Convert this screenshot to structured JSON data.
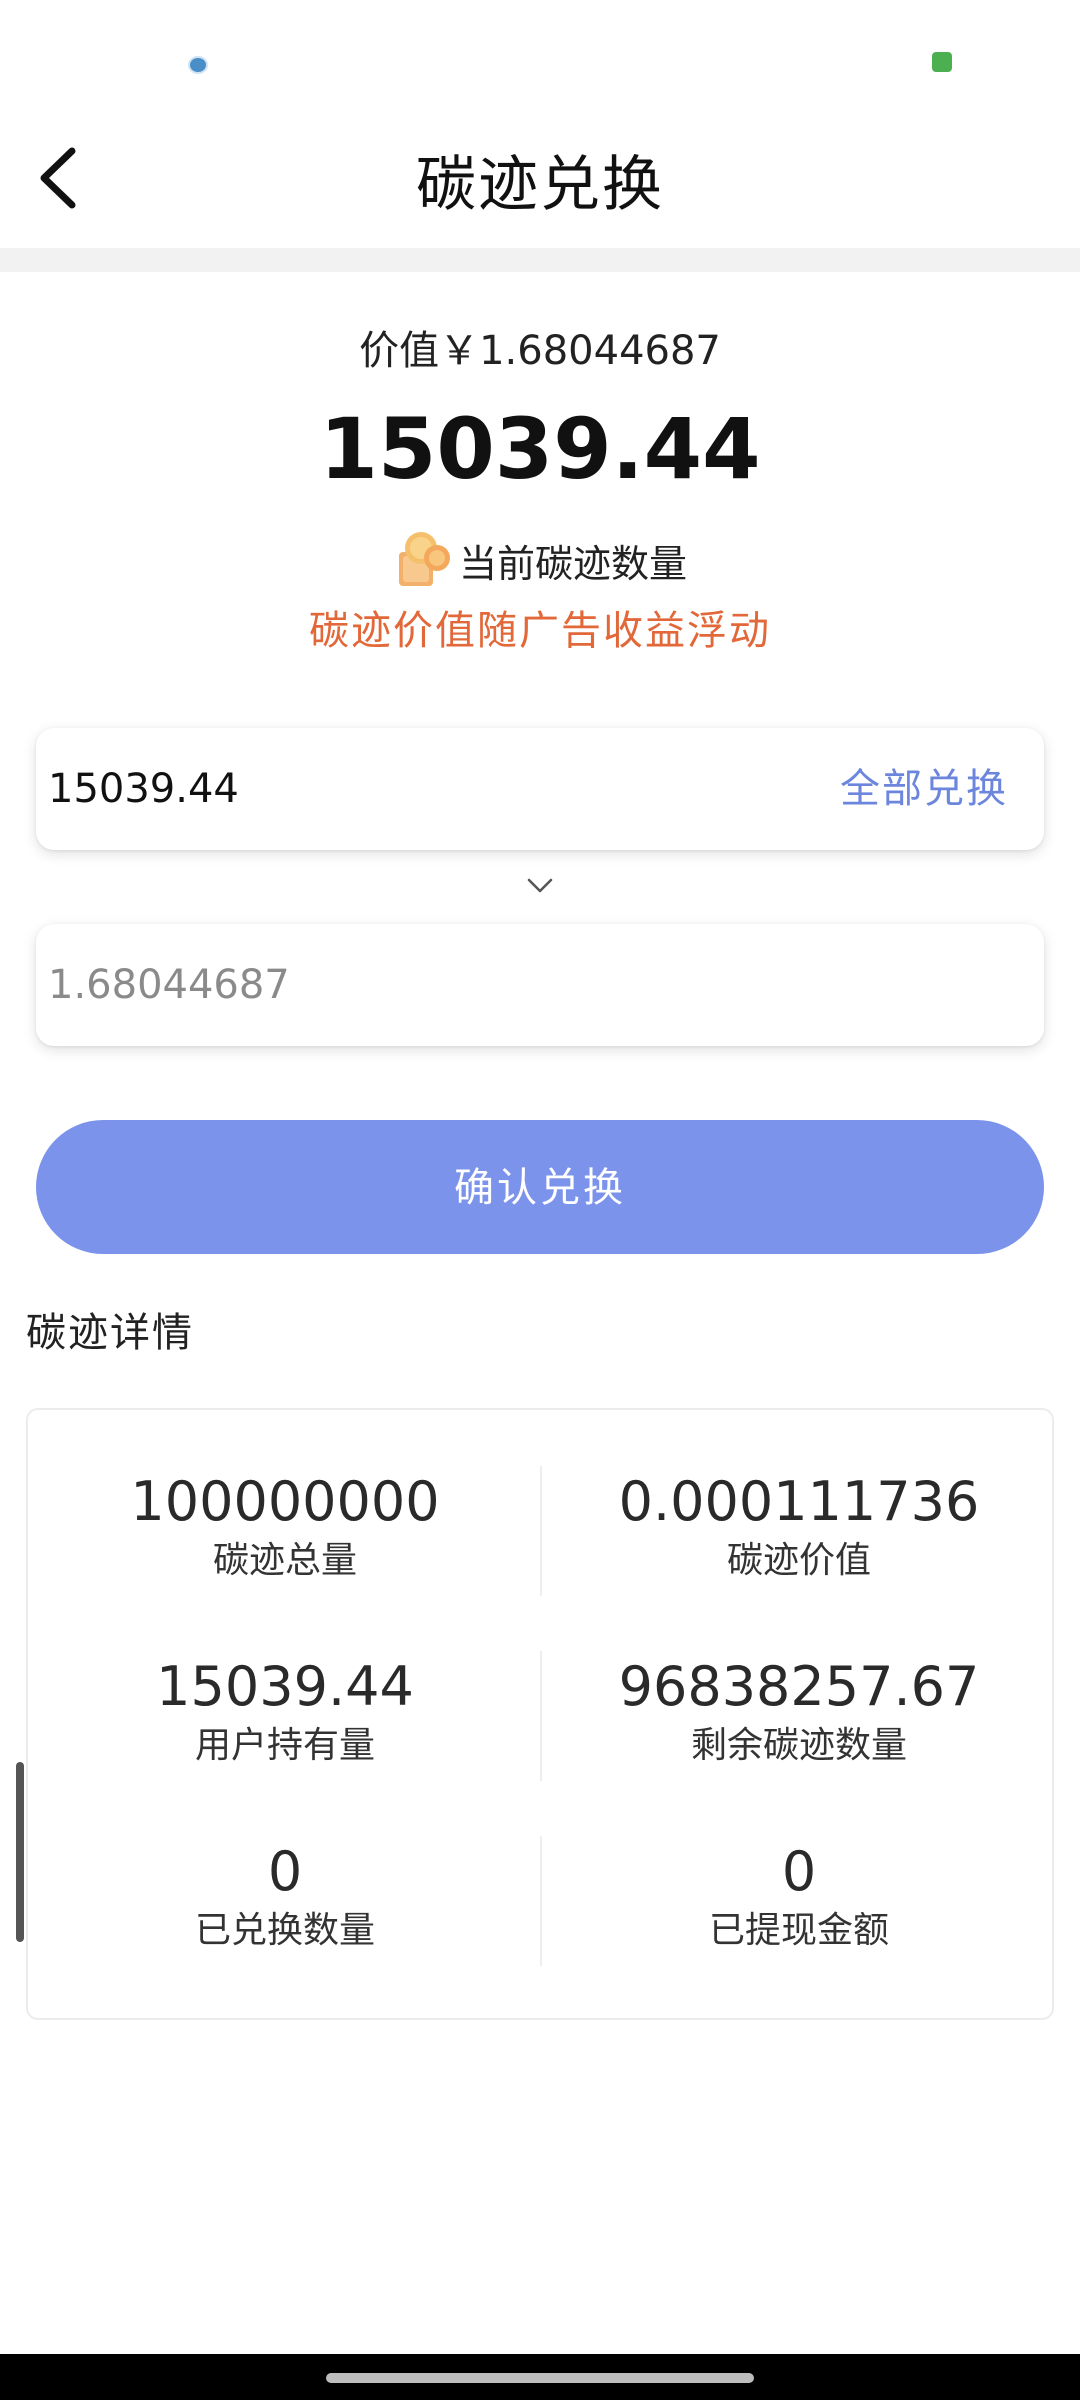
{
  "header": {
    "title": "碳迹兑换"
  },
  "summary": {
    "value_label": "价值￥1.68044687",
    "amount": "15039.44",
    "current_label": "当前碳迹数量",
    "note": "碳迹价值随广告收益浮动"
  },
  "exchange": {
    "input_value": "15039.44",
    "all_exchange_label": "全部兑换",
    "output_placeholder": "1.68044687",
    "confirm_label": "确认兑换"
  },
  "details": {
    "title": "碳迹详情",
    "stats": [
      {
        "value": "100000000",
        "label": "碳迹总量"
      },
      {
        "value": "0.000111736",
        "label": "碳迹价值"
      },
      {
        "value": "15039.44",
        "label": "用户持有量"
      },
      {
        "value": "96838257.67",
        "label": "剩余碳迹数量"
      },
      {
        "value": "0",
        "label": "已兑换数量"
      },
      {
        "value": "0",
        "label": "已提现金额"
      }
    ]
  },
  "colors": {
    "accent": "#7b93ea",
    "link": "#6c86dd",
    "note": "#e2683a"
  }
}
